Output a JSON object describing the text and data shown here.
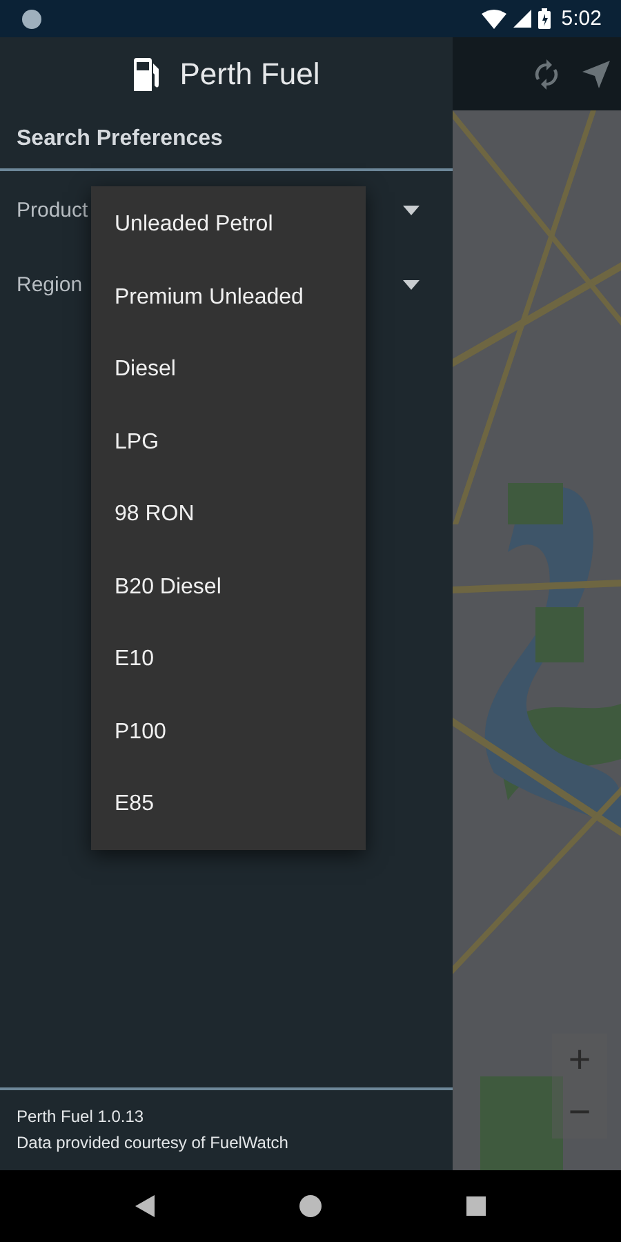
{
  "status_bar": {
    "time": "5:02"
  },
  "drawer": {
    "title": "Perth Fuel",
    "section": "Search Preferences",
    "fields": [
      {
        "label": "Product"
      },
      {
        "label": "Region"
      }
    ],
    "footer": [
      "Perth Fuel 1.0.13",
      "Data provided courtesy of FuelWatch"
    ]
  },
  "menu": {
    "items": [
      "Unleaded Petrol",
      "Premium Unleaded",
      "Diesel",
      "LPG",
      "98 RON",
      "B20 Diesel",
      "E10",
      "P100",
      "E85"
    ]
  },
  "map": {
    "kind": "picture",
    "zoom_controls": [
      "+",
      "−"
    ]
  }
}
